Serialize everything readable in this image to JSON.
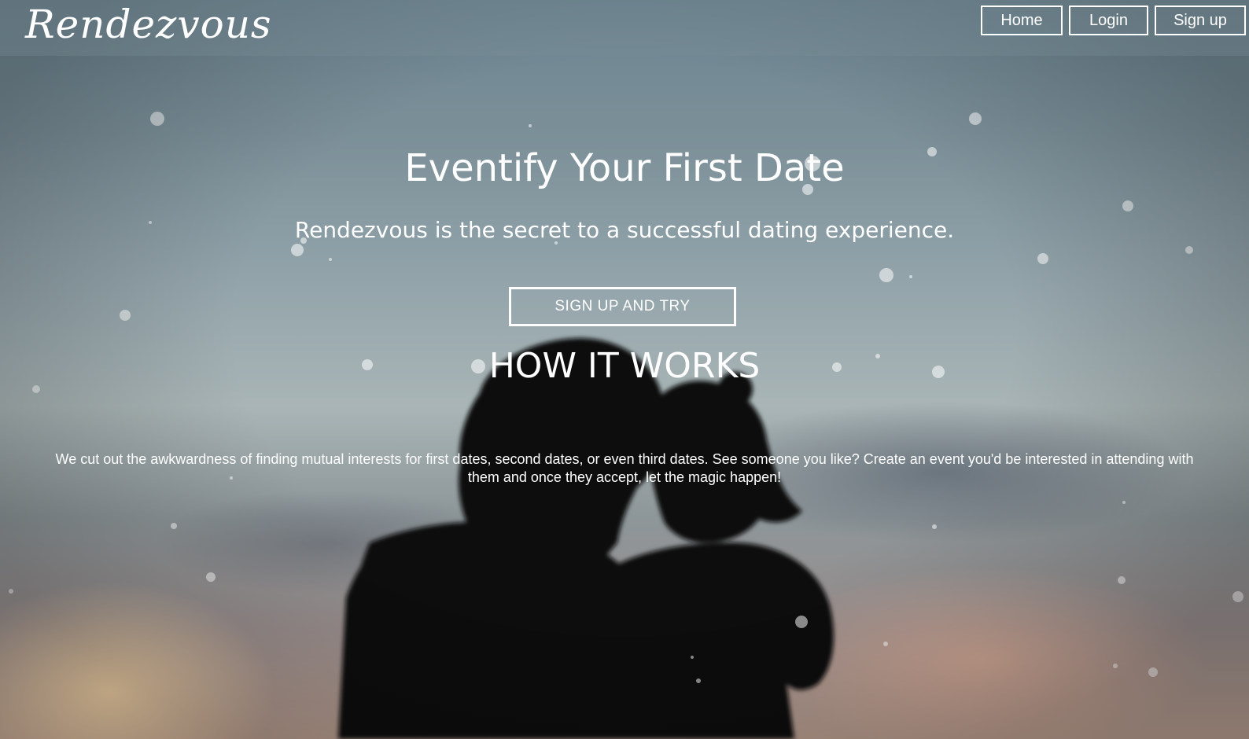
{
  "header": {
    "logo": "Rendezvous",
    "nav": {
      "home": "Home",
      "login": "Login",
      "signup": "Sign up"
    }
  },
  "hero": {
    "title": "Eventify Your First Date",
    "subtitle": "Rendezvous is the secret to a successful dating experience.",
    "cta": "SIGN UP AND TRY"
  },
  "how_it_works": {
    "title": "HOW IT WORKS",
    "text": "We cut out the awkwardness of finding mutual interests for first dates, second dates, or even third dates. See someone you like? Create an event you'd be interested in attending with them and once they accept, let the magic happen!"
  },
  "colors": {
    "text": "#ffffff",
    "silhouette": "#0b0b0c",
    "sky_top": "#6c8592",
    "sunset": "#ffdcaa"
  }
}
